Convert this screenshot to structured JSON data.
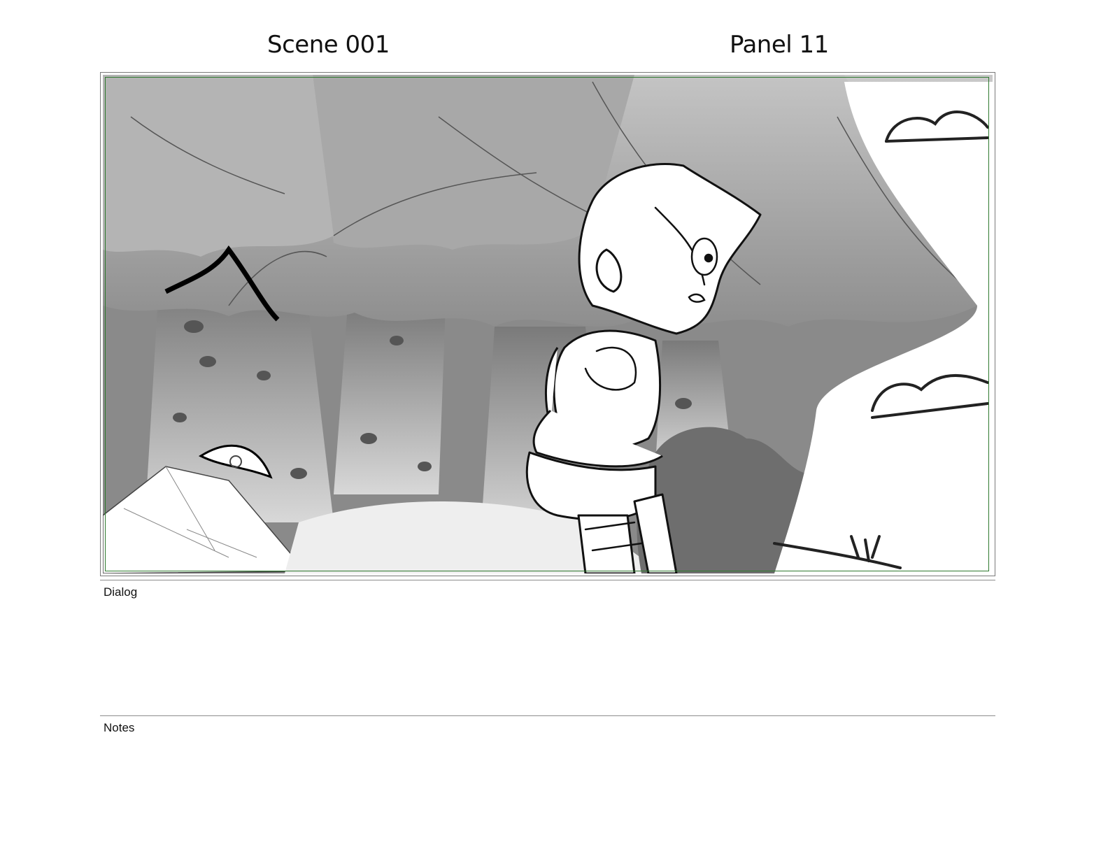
{
  "header": {
    "scene_label": "Scene 001",
    "panel_label": "Panel 11"
  },
  "panel": {
    "image_description_icon": "storyboard-forest-sketch",
    "safe_frame_color": "#2f7a2f",
    "frame_color": "#7a7a7a"
  },
  "sections": {
    "dialog_label": "Dialog",
    "notes_label": "Notes"
  }
}
